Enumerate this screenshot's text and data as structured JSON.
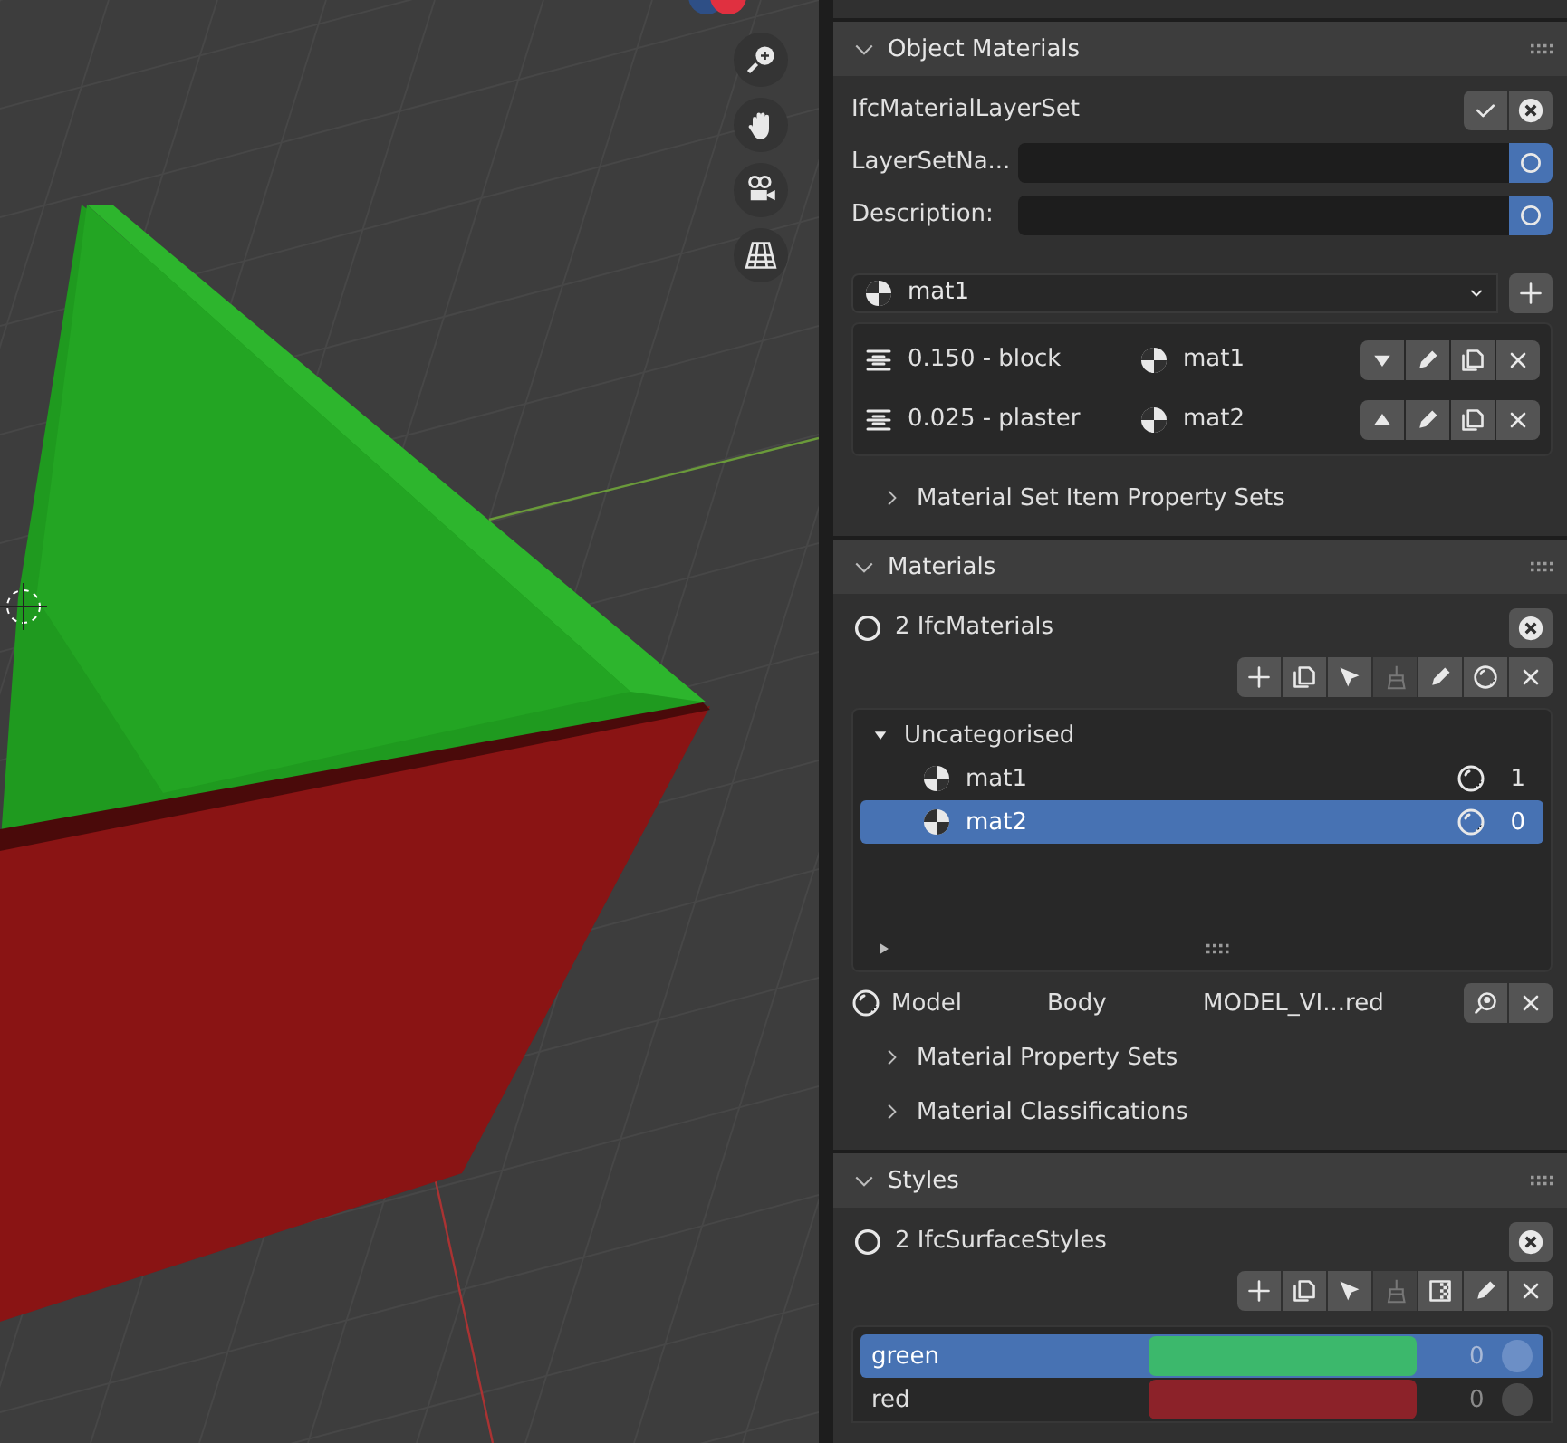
{
  "object_materials": {
    "title": "Object Materials",
    "expanded": true,
    "set_type": "IfcMaterialLayerSet",
    "fields": [
      {
        "label": "LayerSetNa..."
      },
      {
        "label": "Description:"
      }
    ],
    "material_dropdown": {
      "value": "mat1"
    },
    "layers": [
      {
        "label": "0.150 - block",
        "material": "mat1",
        "kind": "down"
      },
      {
        "label": "0.025 - plaster",
        "material": "mat2",
        "kind": "up"
      }
    ],
    "subsections": [
      {
        "title": "Material Set Item Property Sets",
        "expanded": false
      }
    ]
  },
  "materials": {
    "title": "Materials",
    "expanded": true,
    "count_label": "2 IfcMaterials",
    "tools": [
      {
        "kind": "add",
        "disabled": false
      },
      {
        "kind": "duplicate",
        "disabled": false
      },
      {
        "kind": "select",
        "disabled": false
      },
      {
        "kind": "brush",
        "disabled": true
      },
      {
        "kind": "edit",
        "disabled": false
      },
      {
        "kind": "style",
        "disabled": false
      },
      {
        "kind": "remove",
        "disabled": false
      }
    ],
    "tree": [
      {
        "label": "Uncategorised",
        "expanded": true,
        "children": [
          {
            "label": "mat1",
            "count": "1",
            "selected": false
          },
          {
            "label": "mat2",
            "count": "0",
            "selected": true
          }
        ]
      }
    ],
    "representation": [
      "Model",
      "Body",
      "MODEL_VI...red"
    ],
    "subsections": [
      {
        "title": "Material Property Sets",
        "expanded": false
      },
      {
        "title": "Material Classifications",
        "expanded": false
      }
    ]
  },
  "styles": {
    "title": "Styles",
    "expanded": true,
    "count_label": "2 IfcSurfaceStyles",
    "tools": [
      {
        "kind": "add",
        "disabled": false
      },
      {
        "kind": "duplicate",
        "disabled": false
      },
      {
        "kind": "select",
        "disabled": false
      },
      {
        "kind": "brush",
        "disabled": true
      },
      {
        "kind": "texture",
        "disabled": false
      },
      {
        "kind": "edit",
        "disabled": false
      },
      {
        "kind": "remove",
        "disabled": false
      }
    ],
    "items": [
      {
        "name": "green",
        "color": "#3cb86c",
        "count": "0",
        "selected": true
      },
      {
        "name": "red",
        "color": "#8c2229",
        "count": "0",
        "selected": false
      }
    ]
  }
}
